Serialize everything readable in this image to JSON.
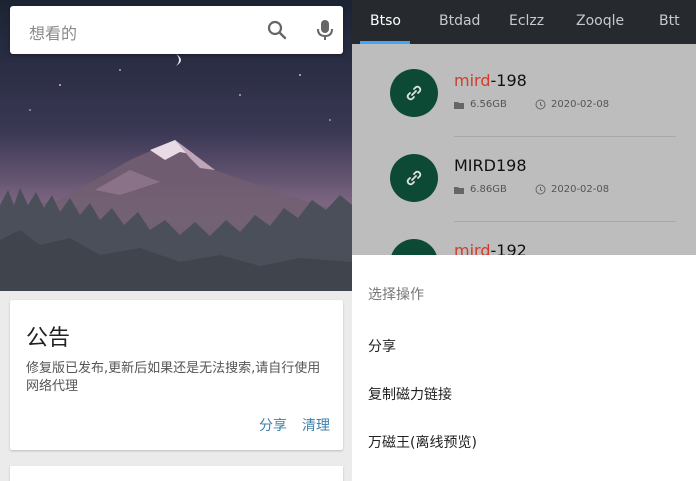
{
  "search": {
    "placeholder": "想看的",
    "icons": [
      "search-icon",
      "mic-icon"
    ]
  },
  "announcement": {
    "title": "公告",
    "body": "修复版已发布,更新后如果还是无法搜索,请自行使用网络代理",
    "actions": [
      "分享",
      "清理"
    ]
  },
  "tabs": [
    {
      "label": "Btso",
      "active": true
    },
    {
      "label": "Btdad",
      "active": false
    },
    {
      "label": "Eclzz",
      "active": false
    },
    {
      "label": "Zooqle",
      "active": false
    },
    {
      "label": "Btt",
      "active": false
    }
  ],
  "results": [
    {
      "name_hl": "mird",
      "name_rest": "-198",
      "size": "6.56GB",
      "date": "2020-02-08"
    },
    {
      "name_hl": "",
      "name_rest": "MIRD198",
      "size": "6.86GB",
      "date": "2020-02-08"
    },
    {
      "name_hl": "mird",
      "name_rest": "-192",
      "size": "",
      "date": ""
    }
  ],
  "sheet": {
    "title": "选择操作",
    "items": [
      "分享",
      "复制磁力链接",
      "万磁王(离线预览)"
    ]
  },
  "colors": {
    "accent": "#42a5f5",
    "tab_bg": "#262a2f",
    "avatar": "#0d4a36",
    "highlight": "#d23c2a",
    "link": "#3f7fa8"
  }
}
